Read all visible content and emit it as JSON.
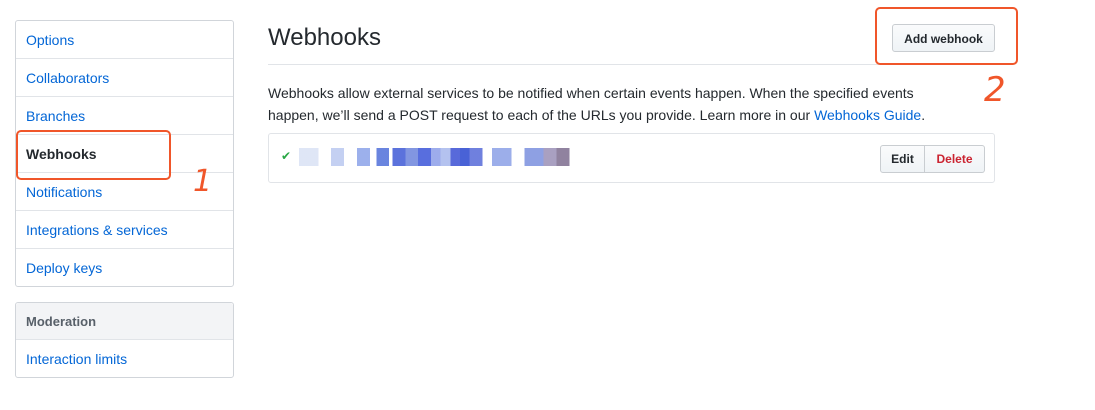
{
  "sidebar": {
    "items": [
      {
        "label": "Options"
      },
      {
        "label": "Collaborators"
      },
      {
        "label": "Branches"
      },
      {
        "label": "Webhooks"
      },
      {
        "label": "Notifications"
      },
      {
        "label": "Integrations & services"
      },
      {
        "label": "Deploy keys"
      }
    ],
    "selected": "Webhooks",
    "moderation": {
      "heading": "Moderation",
      "items": [
        {
          "label": "Interaction limits"
        }
      ]
    }
  },
  "main": {
    "title": "Webhooks",
    "add_button": "Add webhook",
    "description_text": "Webhooks allow external services to be notified when certain events happen. When the specified events happen, we’ll send a POST request to each of the URLs you provide. Learn more in our ",
    "description_link": "Webhooks Guide",
    "description_end": ".",
    "hooks": [
      {
        "status_icon": "check-icon",
        "edit_label": "Edit",
        "delete_label": "Delete"
      }
    ]
  },
  "annotations": {
    "marker_1": "1",
    "marker_2": "2",
    "color": "#f0562a"
  },
  "colors": {
    "link": "#0366d6",
    "danger": "#cb2431",
    "success": "#28a745"
  }
}
